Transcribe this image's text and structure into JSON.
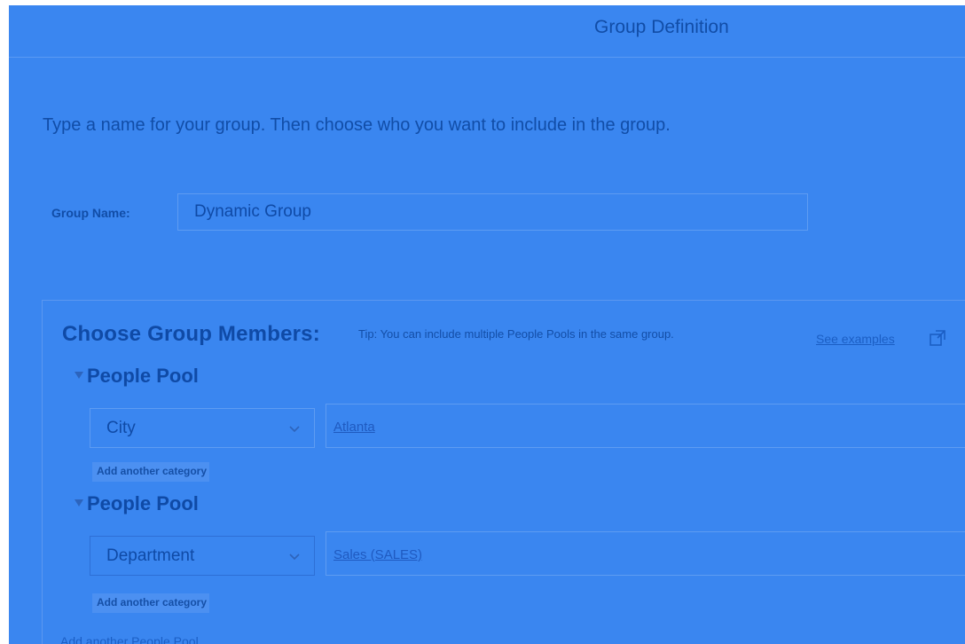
{
  "header": {
    "title": "Group Definition"
  },
  "instructions": "Type a name for your group. Then choose who you want to include in the group.",
  "group_name": {
    "label": "Group Name:",
    "value": "Dynamic Group"
  },
  "members": {
    "title": "Choose Group Members:",
    "tip": "Tip: You can include multiple People Pools in the same group.",
    "see_examples": "See examples",
    "pools": [
      {
        "title": "People Pool",
        "category": "City",
        "value": "Atlanta",
        "add_category": "Add another category"
      },
      {
        "title": "People Pool",
        "category": "Department",
        "value": "Sales (SALES)",
        "add_category": "Add another category"
      }
    ],
    "add_pool": "Add another People Pool"
  },
  "icons": {
    "external_link": "external-link-icon",
    "dropdown": "chevron-down-icon",
    "collapse": "triangle-down-icon"
  },
  "colors": {
    "overlay": "#3a86f0",
    "text": "#114da7",
    "link": "#1b5ec4"
  }
}
